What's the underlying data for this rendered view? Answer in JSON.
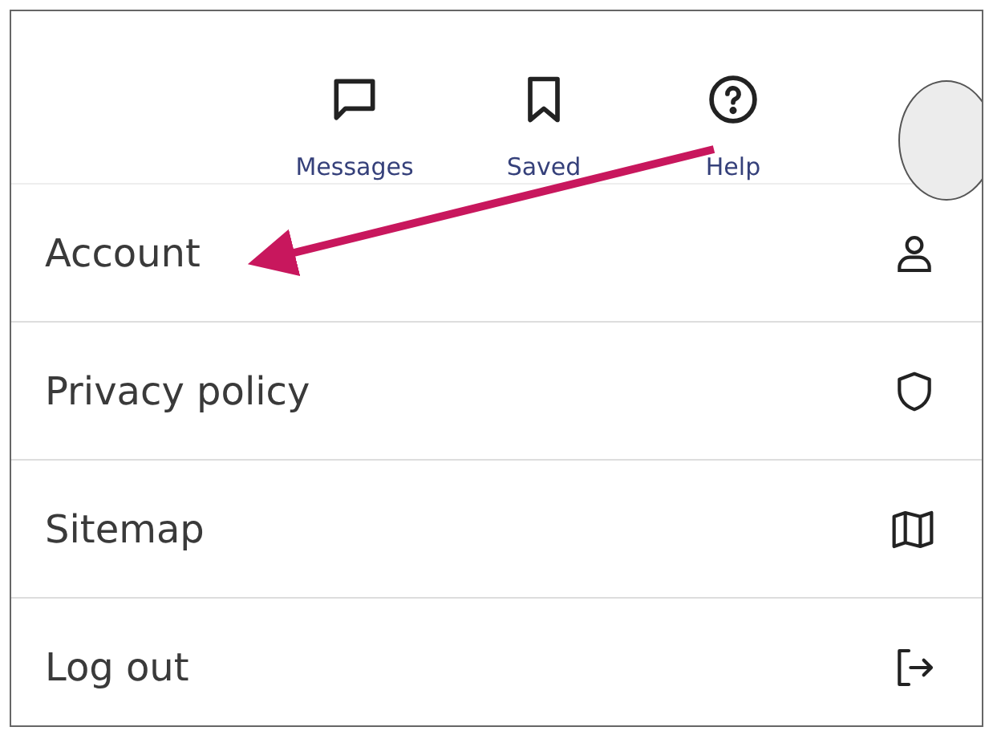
{
  "header": {
    "nav_items": [
      {
        "label": "Messages"
      },
      {
        "label": "Saved"
      },
      {
        "label": "Help"
      }
    ]
  },
  "menu": {
    "items": [
      {
        "label": "Account"
      },
      {
        "label": "Privacy policy"
      },
      {
        "label": "Sitemap"
      },
      {
        "label": "Log out"
      }
    ]
  }
}
